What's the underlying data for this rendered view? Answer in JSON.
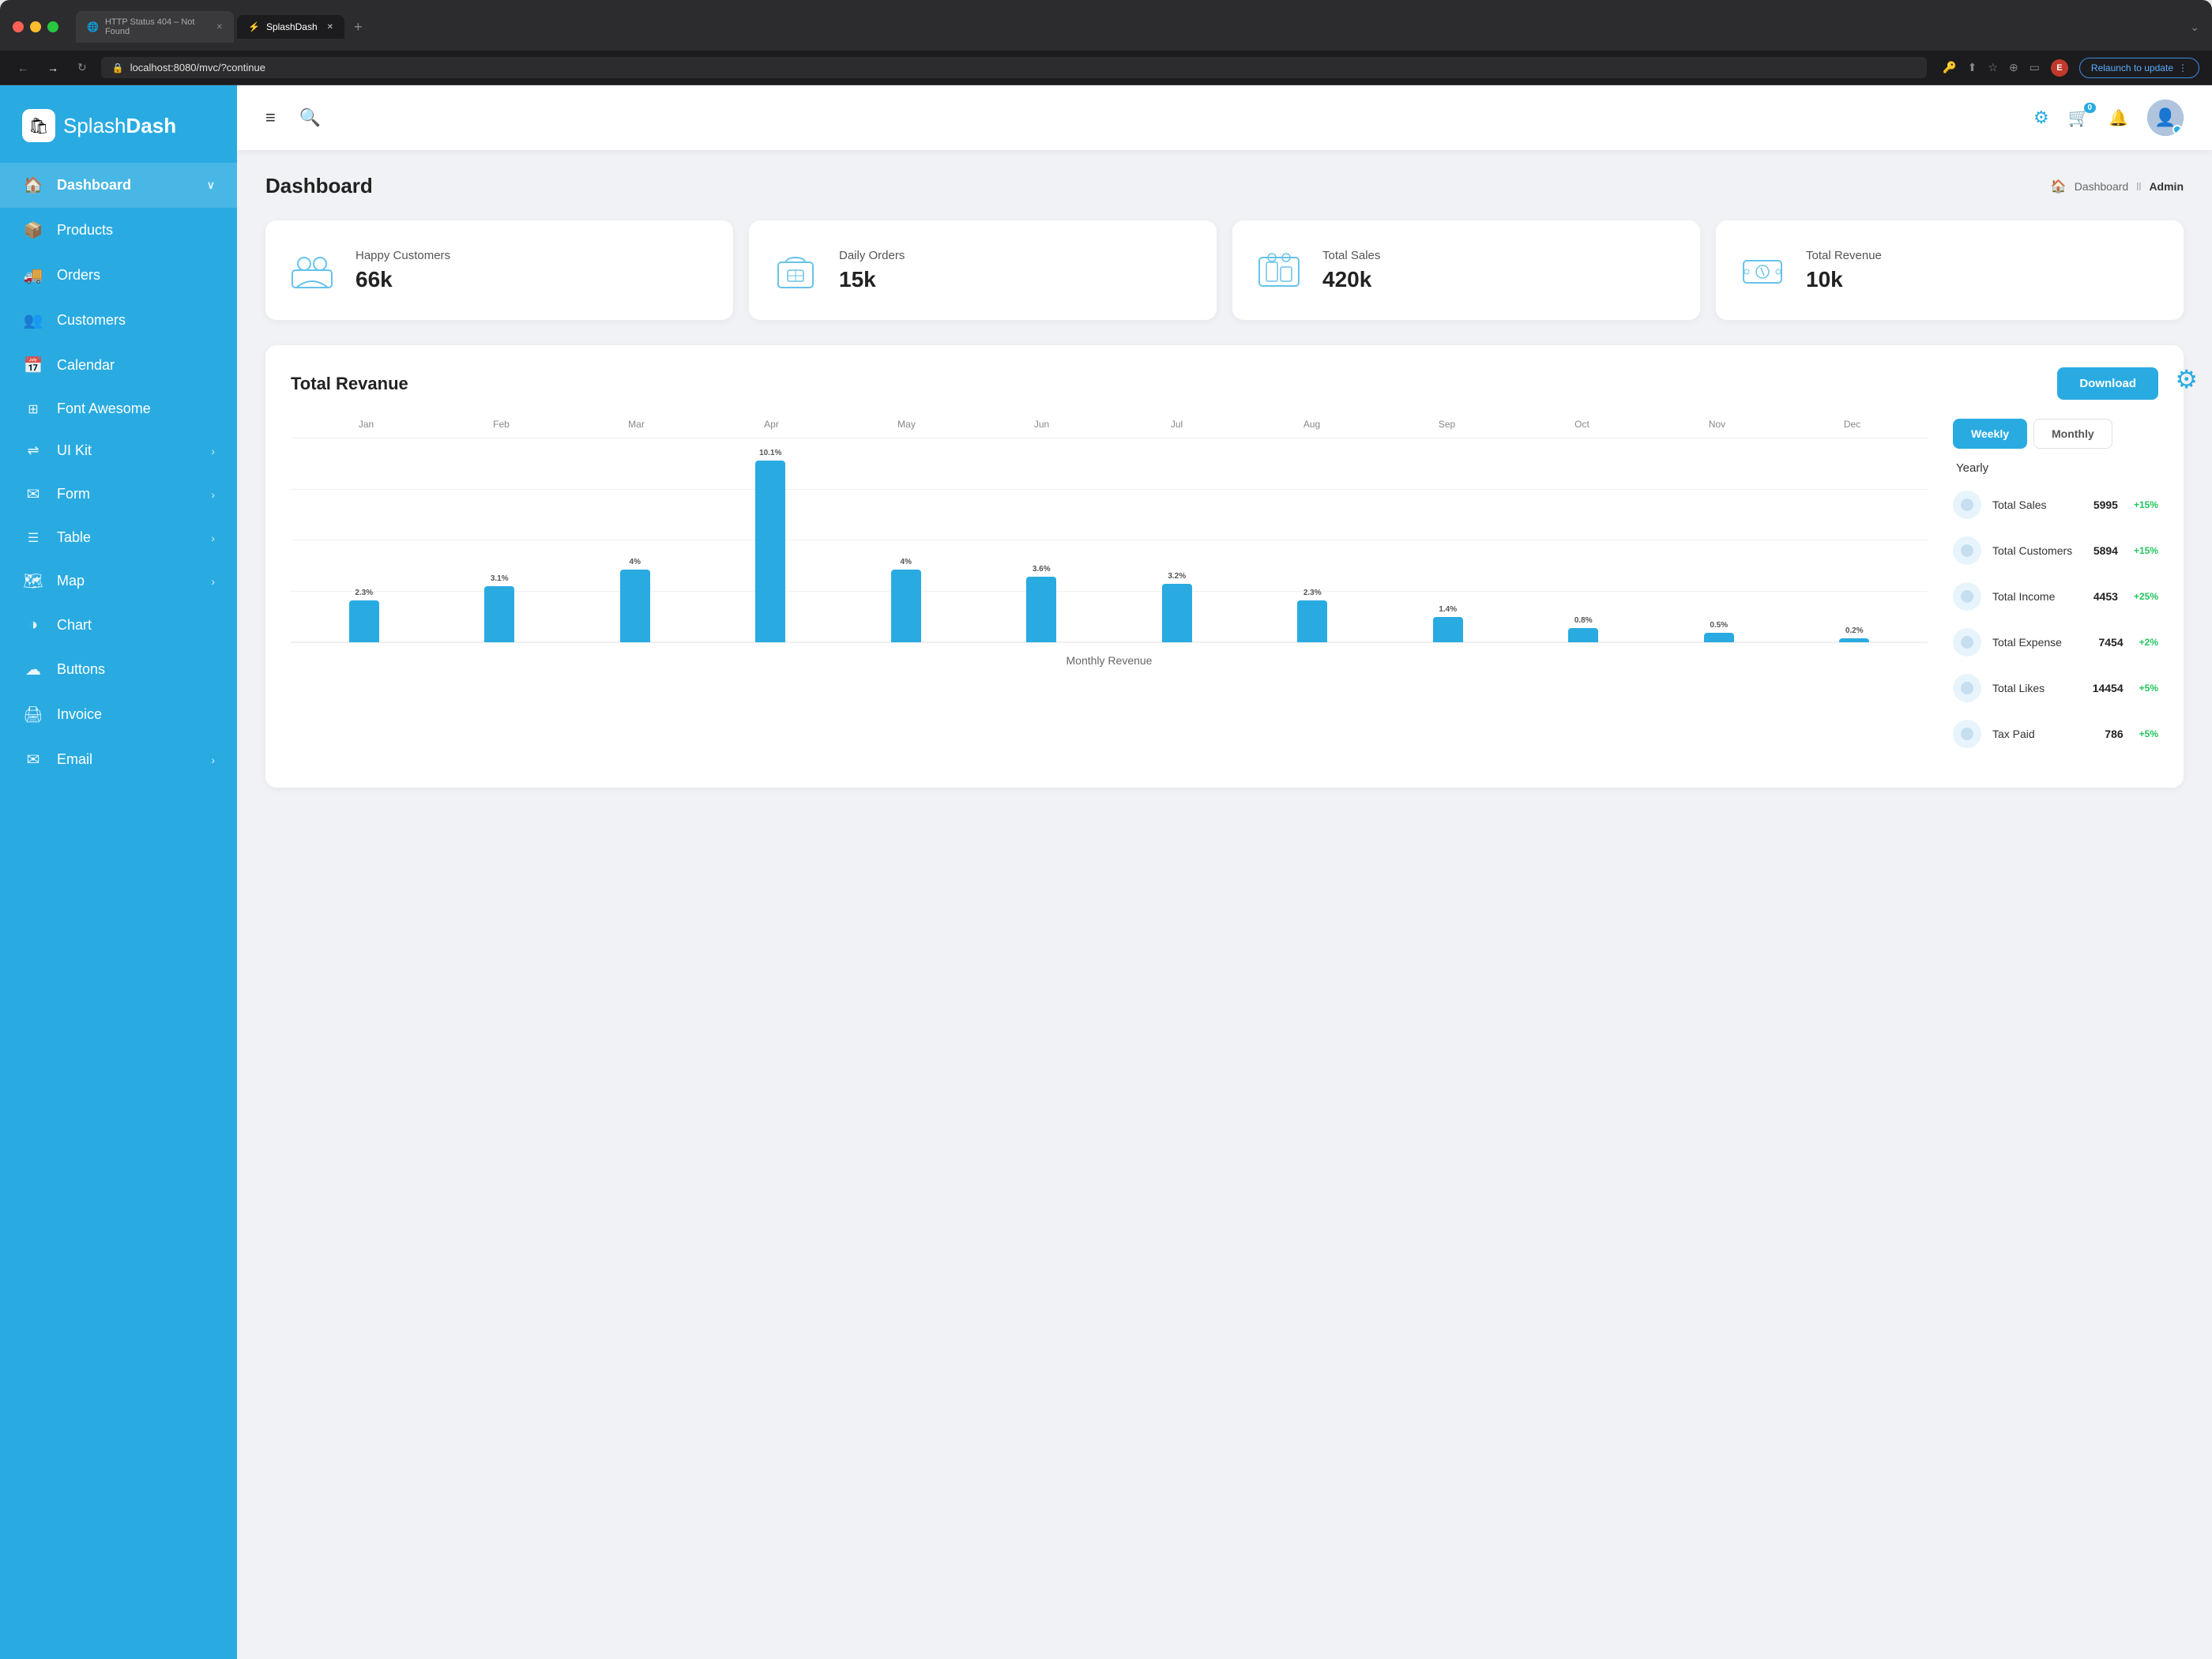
{
  "browser": {
    "tabs": [
      {
        "id": "tab1",
        "title": "HTTP Status 404 – Not Found",
        "active": false
      },
      {
        "id": "tab2",
        "title": "SplashDash",
        "active": true
      }
    ],
    "address": "localhost:8080/mvc/?continue",
    "relaunch_label": "Relaunch to update"
  },
  "sidebar": {
    "logo_text_plain": "Splash",
    "logo_text_bold": "Dash",
    "items": [
      {
        "id": "dashboard",
        "label": "Dashboard",
        "icon": "🏠",
        "active": true,
        "has_arrow": true
      },
      {
        "id": "products",
        "label": "Products",
        "icon": "📦",
        "active": false,
        "has_arrow": false
      },
      {
        "id": "orders",
        "label": "Orders",
        "icon": "🚚",
        "active": false,
        "has_arrow": false
      },
      {
        "id": "customers",
        "label": "Customers",
        "icon": "👥",
        "active": false,
        "has_arrow": false
      },
      {
        "id": "calendar",
        "label": "Calendar",
        "icon": "📅",
        "active": false,
        "has_arrow": false
      },
      {
        "id": "font-awesome",
        "label": "Font Awesome",
        "icon": "⊞",
        "active": false,
        "has_arrow": false
      },
      {
        "id": "ui-kit",
        "label": "UI Kit",
        "icon": "⇌",
        "active": false,
        "has_arrow": true
      },
      {
        "id": "form",
        "label": "Form",
        "icon": "✉",
        "active": false,
        "has_arrow": true
      },
      {
        "id": "table",
        "label": "Table",
        "icon": "☰",
        "active": false,
        "has_arrow": true
      },
      {
        "id": "map",
        "label": "Map",
        "icon": "🗺",
        "active": false,
        "has_arrow": true
      },
      {
        "id": "chart",
        "label": "Chart",
        "icon": "◑",
        "active": false,
        "has_arrow": false
      },
      {
        "id": "buttons",
        "label": "Buttons",
        "icon": "☁",
        "active": false,
        "has_arrow": false
      },
      {
        "id": "invoice",
        "label": "Invoice",
        "icon": "🖨",
        "active": false,
        "has_arrow": false
      },
      {
        "id": "email",
        "label": "Email",
        "icon": "✉",
        "active": false,
        "has_arrow": true
      }
    ]
  },
  "header": {
    "cart_badge": "0",
    "notification_badge": ""
  },
  "page": {
    "title": "Dashboard",
    "breadcrumb_home": "Dashboard",
    "breadcrumb_current": "Admin"
  },
  "stats": [
    {
      "id": "customers",
      "label": "Happy Customers",
      "value": "66k",
      "icon": "👥"
    },
    {
      "id": "orders",
      "label": "Daily Orders",
      "value": "15k",
      "icon": "🏠"
    },
    {
      "id": "sales",
      "label": "Total Sales",
      "value": "420k",
      "icon": "🖨"
    },
    {
      "id": "revenue",
      "label": "Total Revenue",
      "value": "10k",
      "icon": "💰"
    }
  ],
  "revenue_chart": {
    "title": "Total Revanue",
    "download_label": "Download",
    "chart_footer": "Monthly Revenue",
    "months": [
      "Jan",
      "Feb",
      "Mar",
      "Apr",
      "May",
      "Jun",
      "Jul",
      "Aug",
      "Sep",
      "Oct",
      "Nov",
      "Dec"
    ],
    "bars": [
      {
        "month": "Jan",
        "value": 2.3,
        "pct": 23
      },
      {
        "month": "Feb",
        "value": 3.1,
        "pct": 31
      },
      {
        "month": "Mar",
        "value": 4,
        "pct": 40
      },
      {
        "month": "Apr",
        "value": 10.1,
        "pct": 100
      },
      {
        "month": "May",
        "value": 4,
        "pct": 40
      },
      {
        "month": "Jun",
        "value": 3.6,
        "pct": 36
      },
      {
        "month": "Jul",
        "value": 3.2,
        "pct": 32
      },
      {
        "month": "Aug",
        "value": 2.3,
        "pct": 23
      },
      {
        "month": "Sep",
        "value": 1.4,
        "pct": 14
      },
      {
        "month": "Oct",
        "value": 0.8,
        "pct": 8
      },
      {
        "month": "Nov",
        "value": 0.5,
        "pct": 5
      },
      {
        "month": "Dec",
        "value": 0.2,
        "pct": 2
      }
    ],
    "toggles": [
      {
        "id": "weekly",
        "label": "Weekly",
        "active": true
      },
      {
        "id": "monthly",
        "label": "Monthly",
        "active": false
      }
    ],
    "yearly_label": "Yearly",
    "stat_rows": [
      {
        "id": "total-sales",
        "label": "Total Sales",
        "value": "5995",
        "change": "+15%",
        "pos": true
      },
      {
        "id": "total-customers",
        "label": "Total Customers",
        "value": "5894",
        "change": "+15%",
        "pos": true
      },
      {
        "id": "total-income",
        "label": "Total Income",
        "value": "4453",
        "change": "+25%",
        "pos": true
      },
      {
        "id": "total-expense",
        "label": "Total Expense",
        "value": "7454",
        "change": "+2%",
        "pos": true
      },
      {
        "id": "total-likes",
        "label": "Total Likes",
        "value": "14454",
        "change": "+5%",
        "pos": true
      },
      {
        "id": "tax-paid",
        "label": "Tax Paid",
        "value": "786",
        "change": "+5%",
        "pos": true
      }
    ]
  }
}
